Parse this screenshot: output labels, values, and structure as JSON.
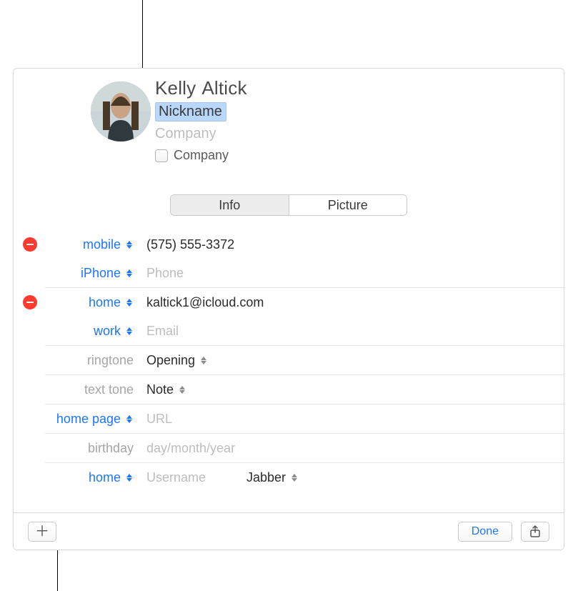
{
  "header": {
    "first_name": "Kelly",
    "last_name": "Altick",
    "nickname_value": "Nickname",
    "company_placeholder": "Company",
    "company_checkbox_label": "Company"
  },
  "tabs": {
    "info": "Info",
    "picture": "Picture"
  },
  "fields": {
    "phone1": {
      "label": "mobile",
      "value": "(575) 555-3372"
    },
    "phone2": {
      "label": "iPhone",
      "placeholder": "Phone"
    },
    "email1": {
      "label": "home",
      "value": "kaltick1@icloud.com"
    },
    "email2": {
      "label": "work",
      "placeholder": "Email"
    },
    "ringtone": {
      "label": "ringtone",
      "value": "Opening"
    },
    "texttone": {
      "label": "text tone",
      "value": "Note"
    },
    "homepage": {
      "label": "home page",
      "placeholder": "URL"
    },
    "birthday": {
      "label": "birthday",
      "placeholder": "day/month/year"
    },
    "im": {
      "label": "home",
      "username_placeholder": "Username",
      "service": "Jabber"
    }
  },
  "footer": {
    "done": "Done"
  }
}
